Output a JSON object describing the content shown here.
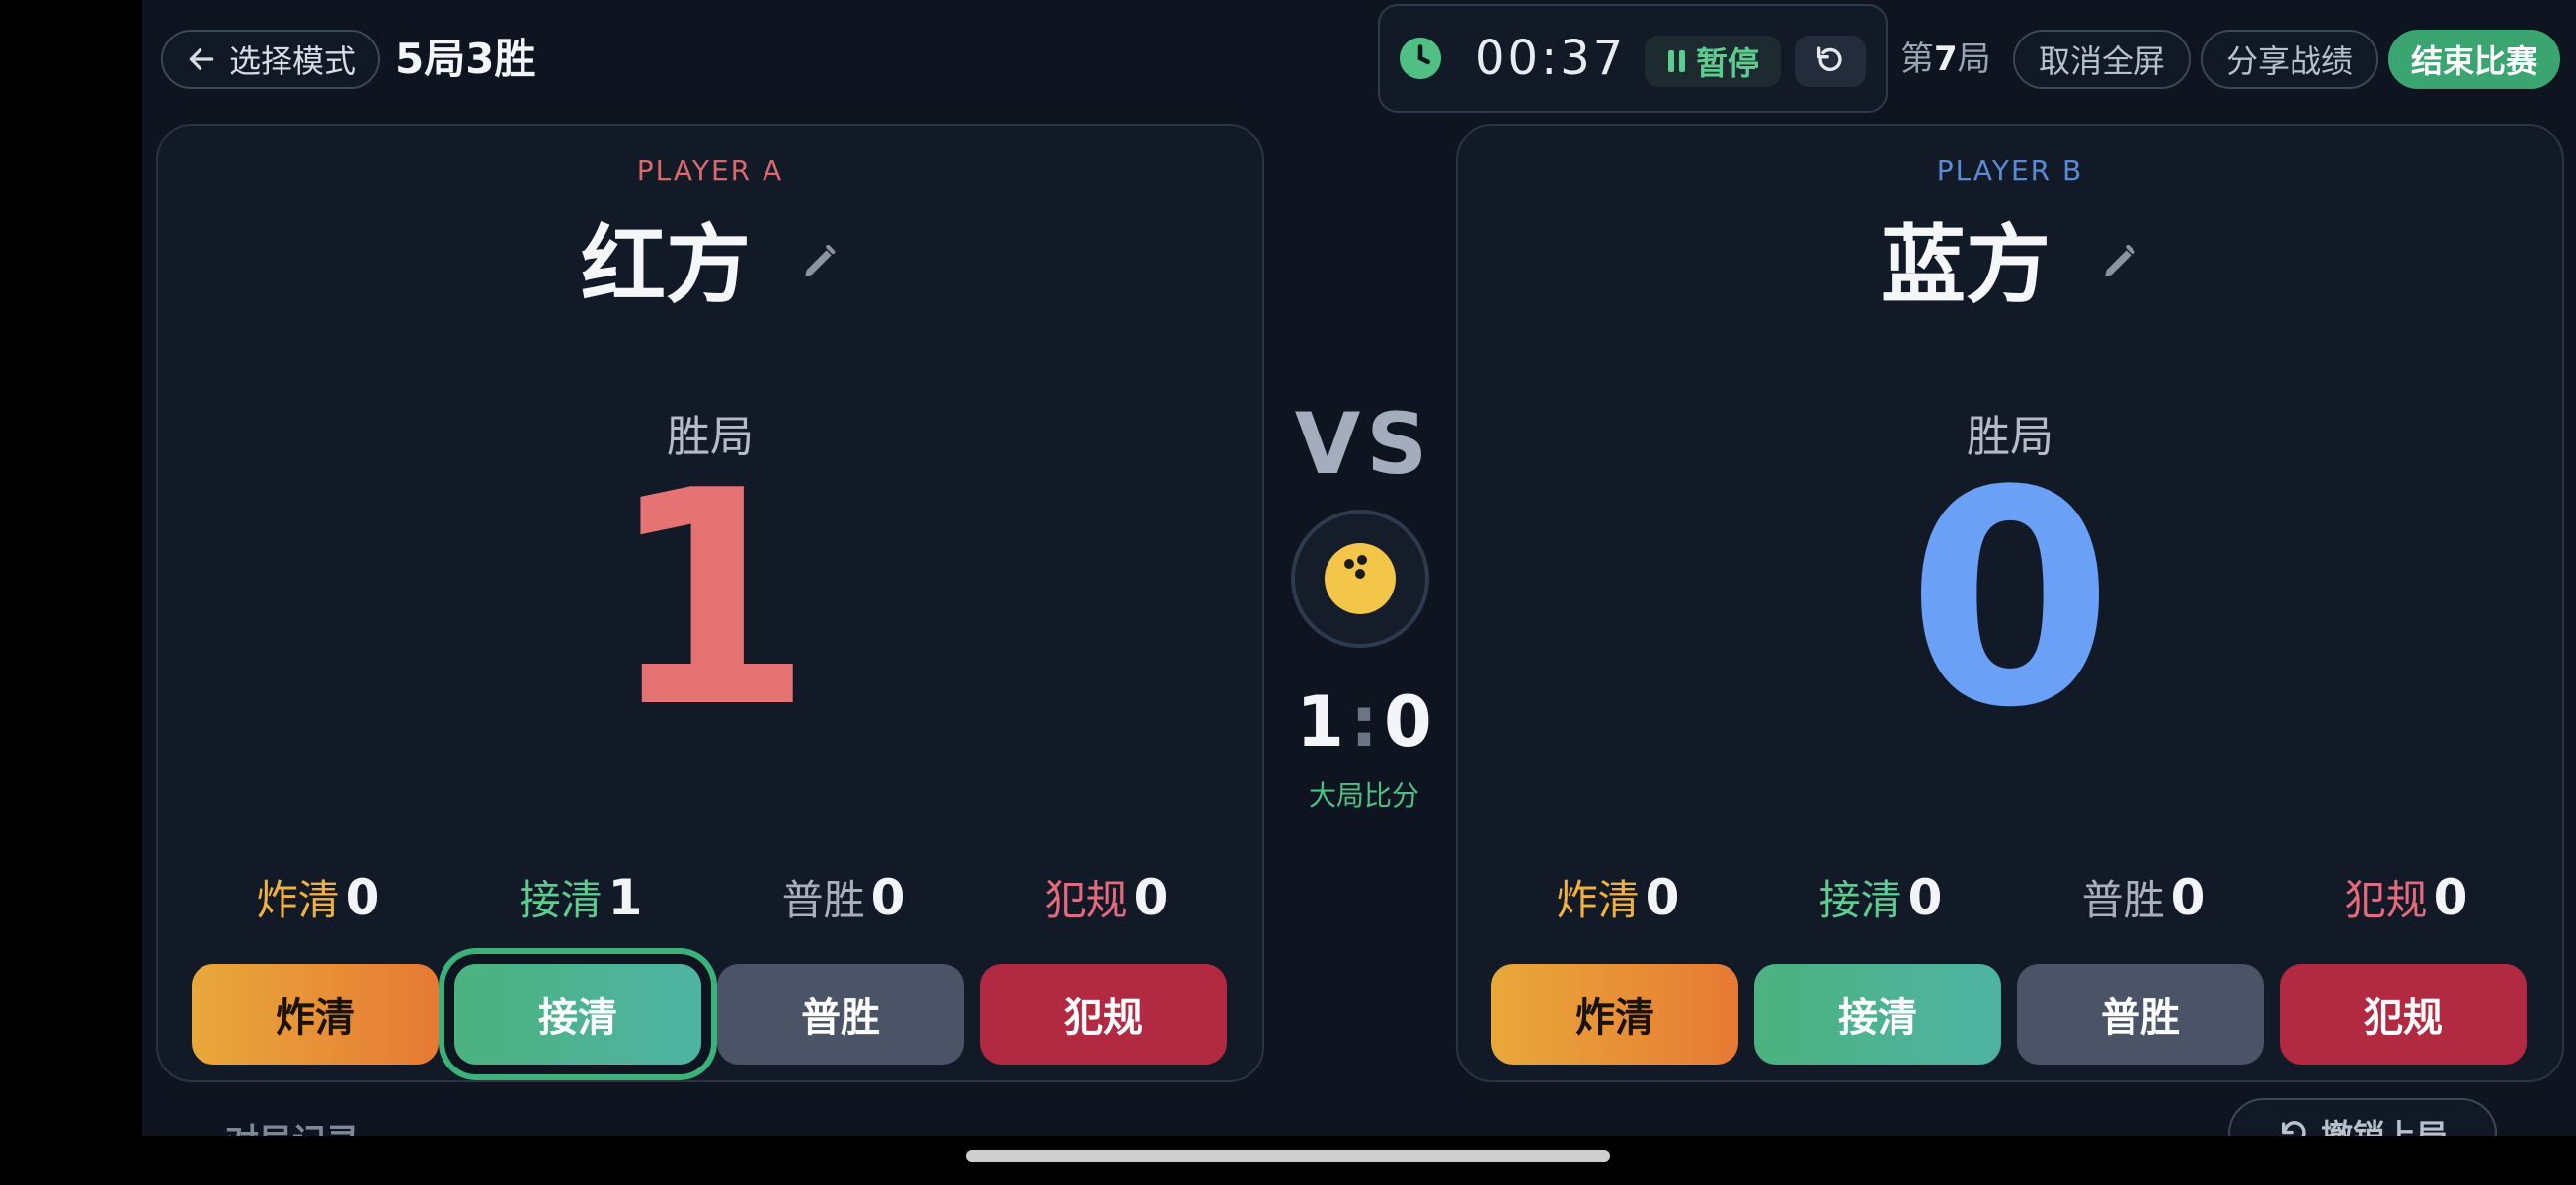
{
  "header": {
    "back_label": "选择模式",
    "mode_title": "5局3胜",
    "timer": "00:37",
    "pause_label": "暂停",
    "round_prefix": "第",
    "round_number": "7",
    "round_suffix": "局",
    "exit_fullscreen_label": "取消全屏",
    "share_label": "分享战绩",
    "end_match_label": "结束比赛"
  },
  "players": [
    {
      "tag": "PLAYER A",
      "name": "红方",
      "wins_label": "胜局",
      "score": "1",
      "color": "#e57373",
      "stats": [
        {
          "label": "炸清",
          "value": "0",
          "color": "#f0b13e"
        },
        {
          "label": "接清",
          "value": "1",
          "color": "#5ccc8f"
        },
        {
          "label": "普胜",
          "value": "0",
          "color": "#a9b0bc"
        },
        {
          "label": "犯规",
          "value": "0",
          "color": "#e46a7c"
        }
      ],
      "actions": [
        "炸清",
        "接清",
        "普胜",
        "犯规"
      ]
    },
    {
      "tag": "PLAYER B",
      "name": "蓝方",
      "wins_label": "胜局",
      "score": "0",
      "color": "#6aa0f5",
      "stats": [
        {
          "label": "炸清",
          "value": "0",
          "color": "#f0b13e"
        },
        {
          "label": "接清",
          "value": "0",
          "color": "#5ccc8f"
        },
        {
          "label": "普胜",
          "value": "0",
          "color": "#a9b0bc"
        },
        {
          "label": "犯规",
          "value": "0",
          "color": "#e46a7c"
        }
      ],
      "actions": [
        "炸清",
        "接清",
        "普胜",
        "犯规"
      ]
    }
  ],
  "center": {
    "vs": "VS",
    "set_score_a": "1",
    "set_score_sep": ":",
    "set_score_b": "0",
    "set_score_label": "大局比分"
  },
  "footer": {
    "history_label": "对局记录",
    "undo_label": "撤销上局"
  },
  "icons": {
    "back": "arrow-left-icon",
    "clock": "clock-icon",
    "pause": "pause-icon",
    "reset": "reset-icon",
    "edit": "pencil-icon",
    "ball": "bowling-ball-icon",
    "undo": "undo-icon"
  }
}
